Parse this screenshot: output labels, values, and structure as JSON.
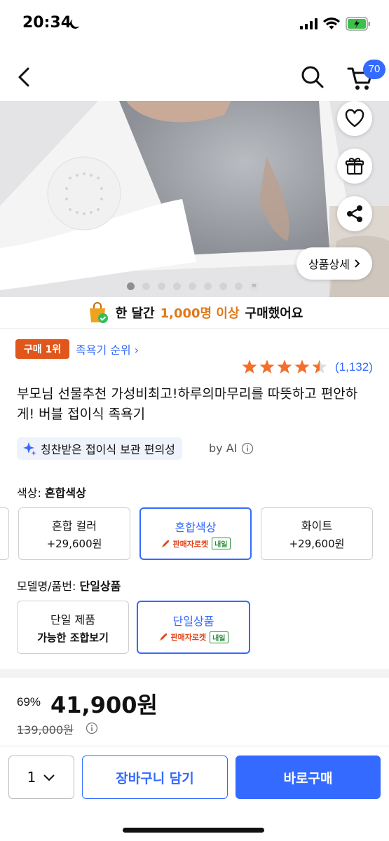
{
  "status_bar": {
    "time": "20:34"
  },
  "header": {
    "cart_count": "70"
  },
  "hero": {
    "detail_button": "상품상세",
    "image_count": 9,
    "active_index": 0
  },
  "buy_banner": {
    "prefix": "한 달간",
    "highlight": "1,000명 이상",
    "suffix": "구매했어요"
  },
  "rank": {
    "badge": "구매 1위",
    "link": "족욕기 순위"
  },
  "rating": {
    "stars": 4.5,
    "count": "(1,132)"
  },
  "product": {
    "title": "부모님 선물추천 가성비최고!하루의마무리를 따뜻하고 편안하게! 버블 접이식 족욕기"
  },
  "ai": {
    "summary": "칭찬받은 접이식 보관 편의성",
    "by": "by AI"
  },
  "color_option": {
    "label": "색상:",
    "selected": "혼합색상",
    "cards": [
      {
        "name": "혼합 컬러",
        "sub": "+29,600원"
      },
      {
        "name": "혼합색상",
        "rocket": "판매자로켓",
        "badge": "내일"
      },
      {
        "name": "화이트",
        "sub": "+29,600원"
      }
    ]
  },
  "model_option": {
    "label": "모델명/품번:",
    "selected": "단일상품",
    "cards": [
      {
        "name": "단일 제품",
        "sub": "가능한 조합보기"
      },
      {
        "name": "단일상품",
        "rocket": "판매자로켓",
        "badge": "내일"
      }
    ]
  },
  "price": {
    "discount": "69%",
    "current": "41,900원",
    "original": "139,000원"
  },
  "bottom": {
    "quantity": "1",
    "add_to_cart": "장바구니 담기",
    "buy_now": "바로구매"
  },
  "colors": {
    "accent": "#346aff",
    "rank_badge": "#e0561b",
    "highlight": "#e0791a",
    "star": "#f2702c"
  }
}
